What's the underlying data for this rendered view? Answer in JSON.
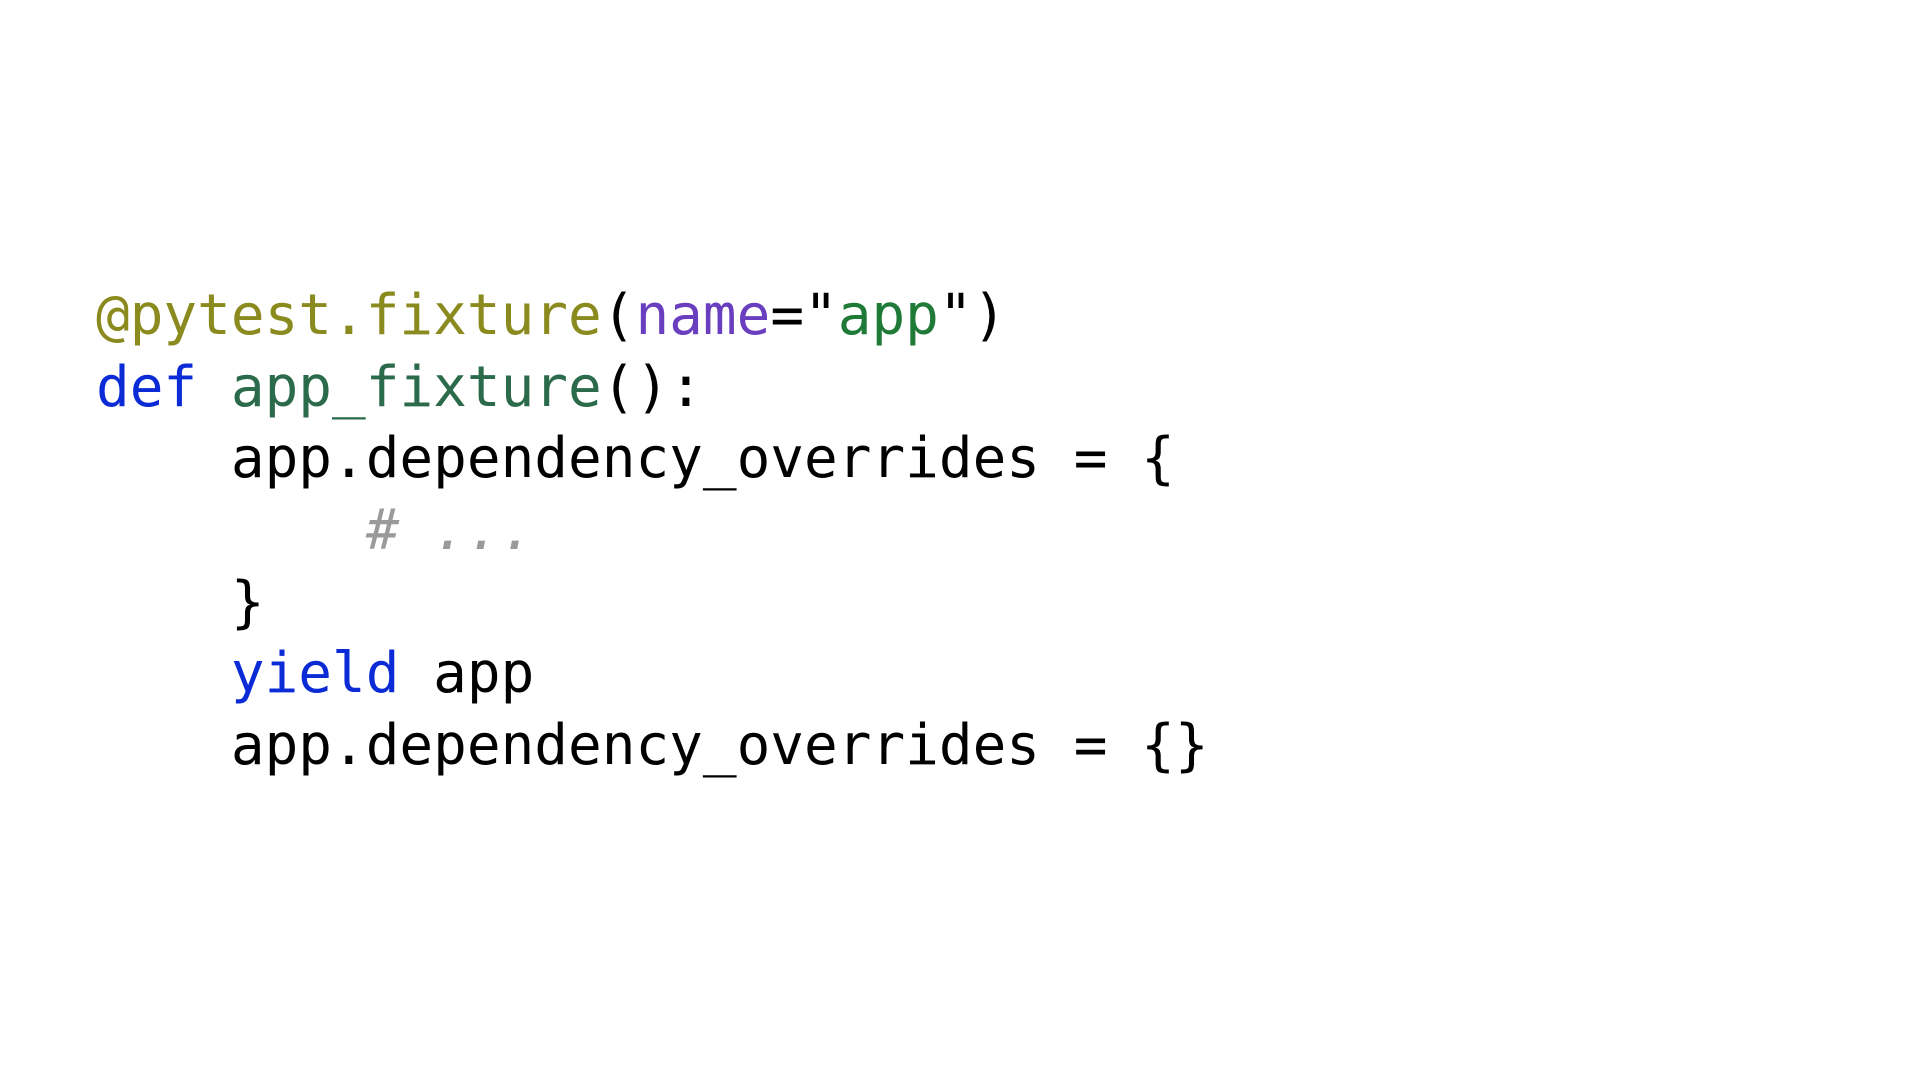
{
  "code": {
    "decorator": "@pytest.fixture",
    "paren_open": "(",
    "param_name": "name",
    "equals_quote_open": "=\"",
    "string_value": "app",
    "quote_close_paren": "\")",
    "def_kw": "def",
    "space": " ",
    "func_name": "app_fixture",
    "def_close": "():",
    "body_l1": "    app.dependency_overrides = {",
    "body_l2_indent": "        ",
    "body_l2_comment": "# ...",
    "body_l3": "    }",
    "yield_indent": "    ",
    "yield_kw": "yield",
    "yield_rest": " app",
    "body_l5": "    app.dependency_overrides = {}"
  }
}
